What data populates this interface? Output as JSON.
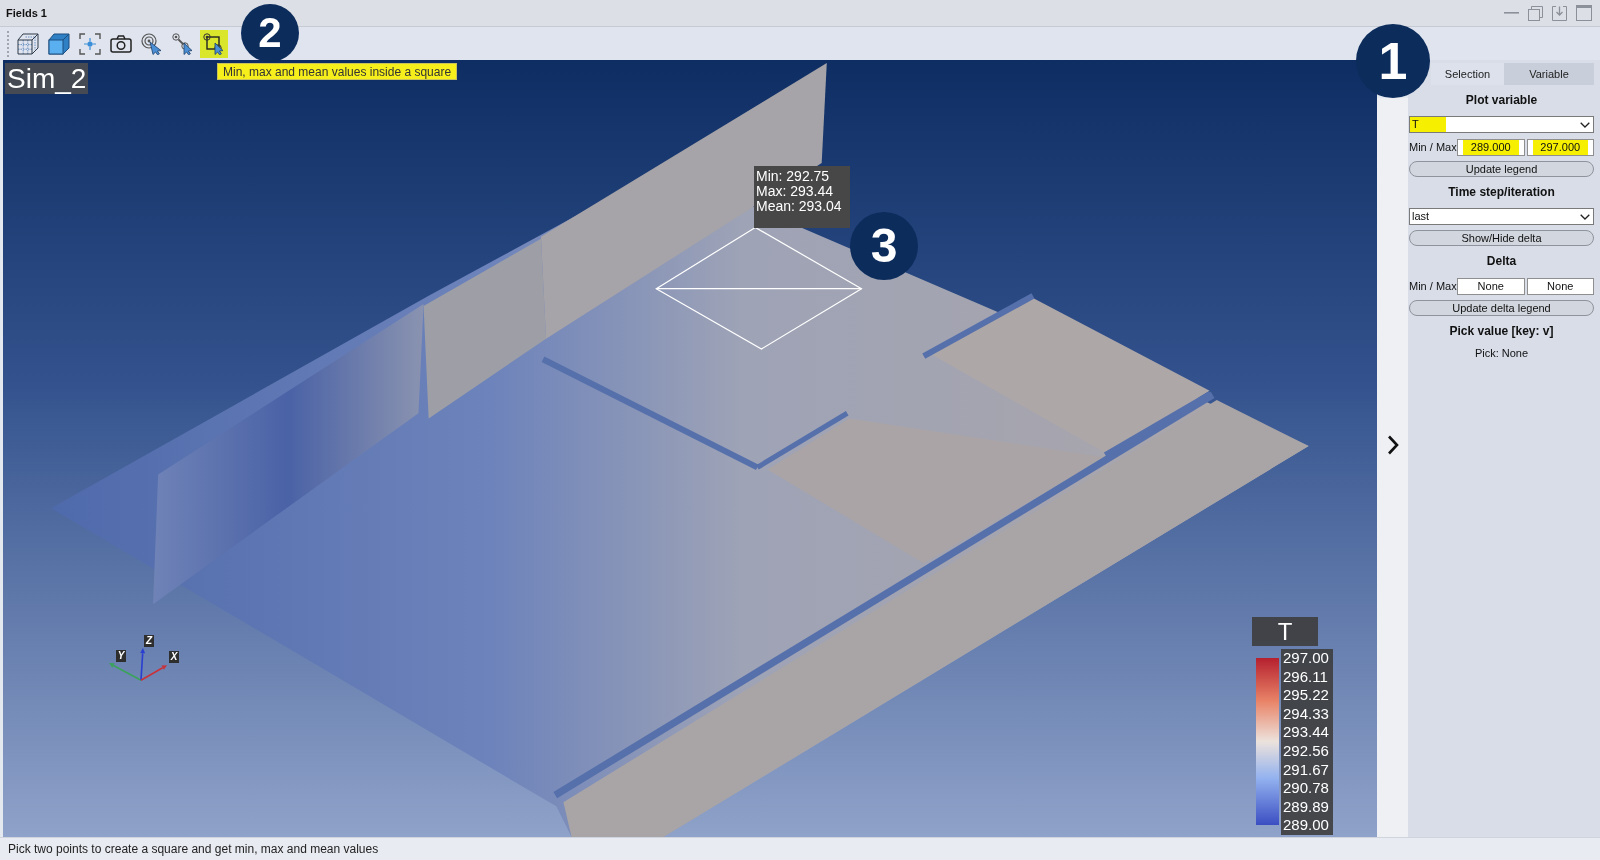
{
  "window": {
    "title": "Fields 1",
    "controls": [
      {
        "kind": "minimize"
      },
      {
        "kind": "restore"
      },
      {
        "kind": "dock"
      },
      {
        "kind": "maximize"
      }
    ]
  },
  "toolbar": {
    "callout": "2",
    "tools": [
      {
        "kind": "wireframe",
        "selected": false
      },
      {
        "kind": "solid",
        "selected": false
      },
      {
        "kind": "focus",
        "selected": false
      },
      {
        "kind": "camera",
        "selected": false
      },
      {
        "kind": "pick_point",
        "selected": false
      },
      {
        "kind": "pick_line",
        "selected": false
      },
      {
        "kind": "pick_square",
        "selected": true
      }
    ],
    "tooltip": "Min, max and mean values inside a square"
  },
  "viewport": {
    "label": "Sim_2",
    "selection": {
      "callout": "3",
      "lines": [
        "Min: 292.75",
        "Max: 293.44",
        "Mean: 293.04"
      ]
    },
    "axes": [
      {
        "label": "Y",
        "color": "#3aa25a"
      },
      {
        "label": "Z",
        "color": "#2a3fd0"
      },
      {
        "label": "X",
        "color": "#c8323c"
      }
    ],
    "legend": {
      "title": "T",
      "ticks": [
        "297.00",
        "296.11",
        "295.22",
        "294.33",
        "293.44",
        "292.56",
        "291.67",
        "290.78",
        "289.89",
        "289.00"
      ]
    }
  },
  "panel": {
    "callout": "1",
    "tabs": [
      {
        "label": "Selection",
        "selected": true
      },
      {
        "label": "Variable",
        "selected": false
      }
    ],
    "sections": [
      {
        "kind": "heading",
        "text": "Plot variable"
      },
      {
        "kind": "select",
        "value": "T",
        "highlighted": true
      },
      {
        "kind": "range",
        "label": "Min / Max",
        "min": "289.000",
        "max": "297.000",
        "highlighted": true
      },
      {
        "kind": "button",
        "label": "Update legend"
      },
      {
        "kind": "heading",
        "text": "Time step/iteration"
      },
      {
        "kind": "select",
        "value": "last",
        "highlighted": false
      },
      {
        "kind": "button",
        "label": "Show/Hide delta"
      },
      {
        "kind": "heading",
        "text": "Delta"
      },
      {
        "kind": "range",
        "label": "Min / Max",
        "min": "None",
        "max": "None",
        "highlighted": false
      },
      {
        "kind": "button",
        "label": "Update delta legend"
      },
      {
        "kind": "heading",
        "text": "Pick value [key: v]"
      },
      {
        "kind": "text",
        "text": "Pick: None"
      }
    ]
  },
  "status_bar": {
    "text": "Pick two points to create a square and get min, max and mean values"
  }
}
